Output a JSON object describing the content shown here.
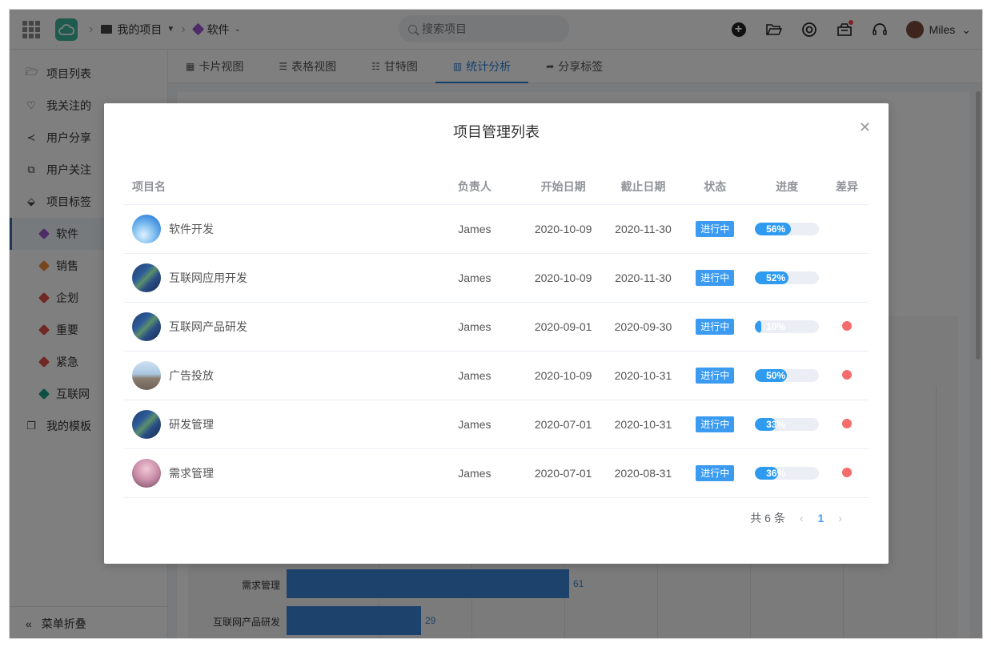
{
  "header": {
    "breadcrumb_project": "我的项目",
    "breadcrumb_tag": "软件",
    "search_placeholder": "搜索项目",
    "user_name": "Miles"
  },
  "sidebar": {
    "items": [
      {
        "label": "项目列表",
        "icon": "folder-icon"
      },
      {
        "label": "我关注的",
        "icon": "heart-icon"
      },
      {
        "label": "用户分享",
        "icon": "share-icon"
      },
      {
        "label": "用户关注",
        "icon": "copy-icon"
      },
      {
        "label": "项目标签",
        "icon": "tag-icon"
      }
    ],
    "tags": [
      {
        "label": "软件",
        "color": "#9b59d0",
        "active": true
      },
      {
        "label": "销售",
        "color": "#f08c3a"
      },
      {
        "label": "企划",
        "color": "#e74c4c"
      },
      {
        "label": "重要",
        "color": "#e74c4c"
      },
      {
        "label": "紧急",
        "color": "#e74c4c"
      },
      {
        "label": "互联网",
        "color": "#16a085"
      }
    ],
    "templates_label": "我的模板",
    "collapse_label": "菜单折叠"
  },
  "tabs": [
    {
      "label": "卡片视图",
      "icon": "grid-icon"
    },
    {
      "label": "表格视图",
      "icon": "list-icon"
    },
    {
      "label": "甘特图",
      "icon": "gantt-icon"
    },
    {
      "label": "统计分析",
      "icon": "bar-chart-icon",
      "active": true
    },
    {
      "label": "分享标签",
      "icon": "share-arrow-icon"
    }
  ],
  "background_chart": {
    "bars": [
      {
        "label": "需求管理",
        "value": 61
      },
      {
        "label": "互联网产品研发",
        "value": 29
      }
    ]
  },
  "modal": {
    "title": "项目管理列表",
    "columns": [
      "项目名",
      "负责人",
      "开始日期",
      "截止日期",
      "状态",
      "进度",
      "差异"
    ],
    "rows": [
      {
        "name": "软件开发",
        "owner": "James",
        "start": "2020-10-09",
        "end": "2020-11-30",
        "status": "进行中",
        "progress": 56,
        "progress_text": "56%",
        "diff": false,
        "avatar": "sky"
      },
      {
        "name": "互联网应用开发",
        "owner": "James",
        "start": "2020-10-09",
        "end": "2020-11-30",
        "status": "进行中",
        "progress": 52,
        "progress_text": "52%",
        "diff": false,
        "avatar": "code"
      },
      {
        "name": "互联网产品研发",
        "owner": "James",
        "start": "2020-09-01",
        "end": "2020-09-30",
        "status": "进行中",
        "progress": 10,
        "progress_text": "10%",
        "diff": true,
        "avatar": "code"
      },
      {
        "name": "广告投放",
        "owner": "James",
        "start": "2020-10-09",
        "end": "2020-10-31",
        "status": "进行中",
        "progress": 50,
        "progress_text": "50%",
        "diff": true,
        "avatar": "road"
      },
      {
        "name": "研发管理",
        "owner": "James",
        "start": "2020-07-01",
        "end": "2020-10-31",
        "status": "进行中",
        "progress": 33,
        "progress_text": "33%",
        "diff": true,
        "avatar": "code"
      },
      {
        "name": "需求管理",
        "owner": "James",
        "start": "2020-07-01",
        "end": "2020-08-31",
        "status": "进行中",
        "progress": 36,
        "progress_text": "36%",
        "diff": true,
        "avatar": "blossom"
      }
    ],
    "pager": {
      "total": "共 6 条",
      "page": "1"
    }
  }
}
